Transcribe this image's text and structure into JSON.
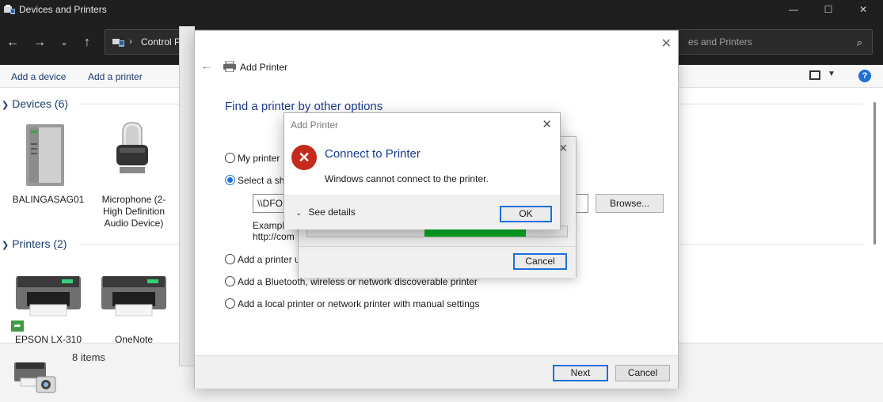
{
  "window": {
    "title": "Devices and Printers",
    "minimize": "—",
    "maximize": "☐",
    "close": "✕"
  },
  "address": {
    "breadcrumb": "Control P",
    "separator": "›",
    "search_placeholder": "es and Printers"
  },
  "toolbar": {
    "add_device": "Add a device",
    "add_printer": "Add a printer",
    "help": "?"
  },
  "devices_group": {
    "heading": "Devices (6)",
    "items": [
      {
        "label": "BALINGASAG01"
      },
      {
        "label": "Microphone (2- High Definition Audio Device)"
      }
    ]
  },
  "printers_group": {
    "heading": "Printers (2)",
    "items": [
      {
        "label": "EPSON LX-310"
      },
      {
        "label": "OneNote"
      }
    ]
  },
  "details": {
    "count": "8 items"
  },
  "wizard": {
    "title": "Add Printer",
    "heading": "Find a printer by other options",
    "options": [
      {
        "label": "My printer",
        "selected": false
      },
      {
        "label": "Select a sha",
        "selected": true
      },
      {
        "label": "Add a printer u",
        "selected": false
      },
      {
        "label": "Add a Bluetooth, wireless or network discoverable printer",
        "selected": false
      },
      {
        "label": "Add a local printer or network printer with manual settings",
        "selected": false
      }
    ],
    "share_value": "\\\\DFO",
    "browse_label": "Browse...",
    "example_line1": "Exampl",
    "example_line2": "http://com",
    "next_label": "Next",
    "cancel_label": "Cancel"
  },
  "progress_dialog": {
    "cancel_label": "Cancel"
  },
  "error_dialog": {
    "title": "Add Printer",
    "heading": "Connect to Printer",
    "message": "Windows cannot connect to the printer.",
    "see_details": "See details",
    "ok_label": "OK"
  },
  "colors": {
    "accent": "#1e6fd9",
    "error": "#c42b1c",
    "progress": "#06b025",
    "link_text": "#1a3c6e"
  }
}
